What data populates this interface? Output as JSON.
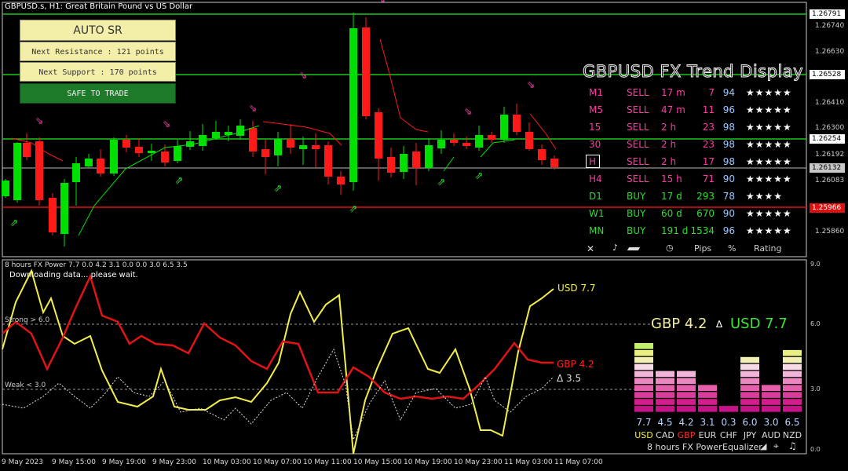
{
  "chart": {
    "title": "GBPUSD.s, H1:  Great Britain Pound vs US Dollar",
    "price_ticks": [
      "1.26740",
      "1.26630",
      "1.26410",
      "1.26300",
      "1.26192",
      "1.26083",
      "1.25860"
    ],
    "level_labels": {
      "top_resistance": "1.26791",
      "resistance": "1.26528",
      "support_mid": "1.26254",
      "current": "1.26132",
      "support_red": "1.25966"
    },
    "colors": {
      "bull": "#00e000",
      "bear": "#ff1a1a",
      "resistance_line": "#19c819",
      "support_line": "#e01010",
      "arrow_sell": "#e0409c",
      "arrow_buy": "#33d633"
    }
  },
  "auto_sr": {
    "title": "AUTO SR",
    "next_resistance": "Next Resistance : 121 points",
    "next_support": "Next Support : 170 points",
    "status": "SAFE TO TRADE"
  },
  "trend": {
    "title": "GBPUSD FX Trend Display",
    "rows": [
      {
        "tf": "M1",
        "signal": "SELL",
        "dur": "17 m",
        "pips": "7",
        "pct": "94",
        "stars": "★★★★★"
      },
      {
        "tf": "M5",
        "signal": "SELL",
        "dur": "47 m",
        "pips": "11",
        "pct": "96",
        "stars": "★★★★★"
      },
      {
        "tf": "15",
        "signal": "SELL",
        "dur": "2 h",
        "pips": "23",
        "pct": "98",
        "stars": "★★★★★"
      },
      {
        "tf": "30",
        "signal": "SELL",
        "dur": "2 h",
        "pips": "23",
        "pct": "98",
        "stars": "★★★★★"
      },
      {
        "tf": "H",
        "signal": "SELL",
        "dur": "2 h",
        "pips": "17",
        "pct": "98",
        "stars": "★★★★★"
      },
      {
        "tf": "H4",
        "signal": "SELL",
        "dur": "15 h",
        "pips": "71",
        "pct": "90",
        "stars": "★★★★★"
      },
      {
        "tf": "D1",
        "signal": "BUY",
        "dur": "17 d",
        "pips": "293",
        "pct": "78",
        "stars": "★★★★"
      },
      {
        "tf": "W1",
        "signal": "BUY",
        "dur": "60 d",
        "pips": "670",
        "pct": "90",
        "stars": "★★★★★"
      },
      {
        "tf": "MN",
        "signal": "BUY",
        "dur": "191 d",
        "pips": "1534",
        "pct": "96",
        "stars": "★★★★★"
      }
    ],
    "footer": {
      "close": "✕",
      "pips": "Pips",
      "pct": "%",
      "rating": "Rating"
    }
  },
  "power": {
    "title": "8 hours FX Power 7.7 0.0 4.2 3.1 0.0 0.0 3.0 6.5 3.5",
    "loading": "Downloading data... please wait.",
    "strong": "Strong > 6.0",
    "weak": "Weak < 3.0",
    "usd_label": "USD 7.7",
    "gbp_label": "GBP 4.2",
    "delta_label": "Δ 3.5",
    "big_gbp": "GBP 4.2",
    "big_delta": "∆",
    "big_usd": "USD 7.7",
    "y_ticks": [
      "9.0",
      "6.0",
      "3.0",
      "0.0"
    ],
    "equalizer": {
      "currencies": [
        "USD",
        "CAD",
        "GBP",
        "EUR",
        "CHF",
        "JPY",
        "AUD",
        "NZD"
      ],
      "values": [
        "7.7",
        "4.5",
        "4.2",
        "3.1",
        "0.3",
        "6.0",
        "3.0",
        "6.5"
      ],
      "levels": [
        7.7,
        4.5,
        4.2,
        3.1,
        0.3,
        6.0,
        3.0,
        6.5
      ],
      "footer_period": "8 hours",
      "footer_name": "FX Power",
      "footer_mode": "Equalizer"
    }
  },
  "x_axis": [
    "9 May 2023",
    "9 May 15:00",
    "9 May 19:00",
    "9 May 23:00",
    "10 May 03:00",
    "10 May 07:00",
    "10 May 11:00",
    "10 May 15:00",
    "10 May 19:00",
    "10 May 23:00",
    "11 May 03:00",
    "11 May 07:00"
  ]
}
